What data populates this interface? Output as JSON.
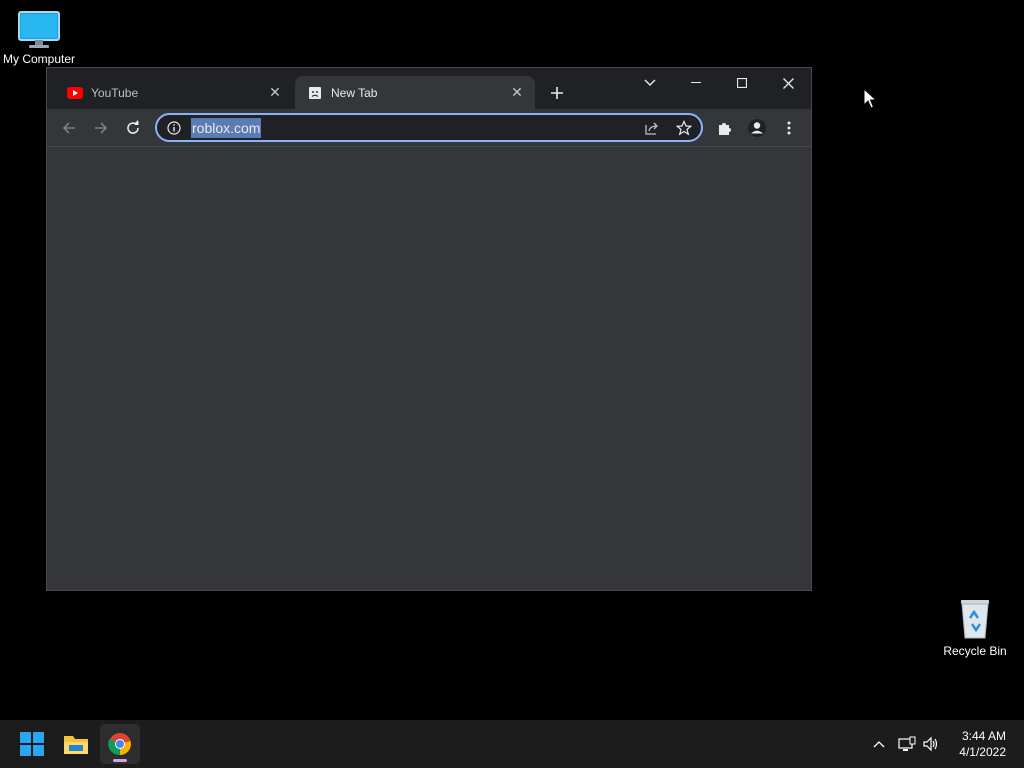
{
  "desktop": {
    "icons": [
      {
        "label": "My Computer"
      },
      {
        "label": "Recycle Bin"
      }
    ]
  },
  "browser": {
    "tabs": [
      {
        "title": "YouTube",
        "active": false,
        "favicon": "youtube-icon"
      },
      {
        "title": "New Tab",
        "active": true,
        "favicon": "sad-page-icon"
      }
    ],
    "omnibox": {
      "value": "roblox.com",
      "selected": true
    },
    "window_controls": [
      "tab-search",
      "minimize",
      "maximize",
      "close"
    ],
    "toolbar_icons": [
      "back",
      "forward",
      "reload",
      "share",
      "bookmark-star",
      "extensions",
      "profile",
      "menu"
    ]
  },
  "taskbar": {
    "apps": [
      "start",
      "file-explorer",
      "chrome"
    ],
    "active_app": "chrome",
    "tray": [
      "show-hidden-icons",
      "network",
      "volume"
    ],
    "clock": {
      "time": "3:44 AM",
      "date": "4/1/2022"
    }
  },
  "colors": {
    "accent": "#8ab4f8",
    "tab_bg": "#202124",
    "content_bg": "#35363a",
    "taskbar": "#1c1c1c"
  }
}
